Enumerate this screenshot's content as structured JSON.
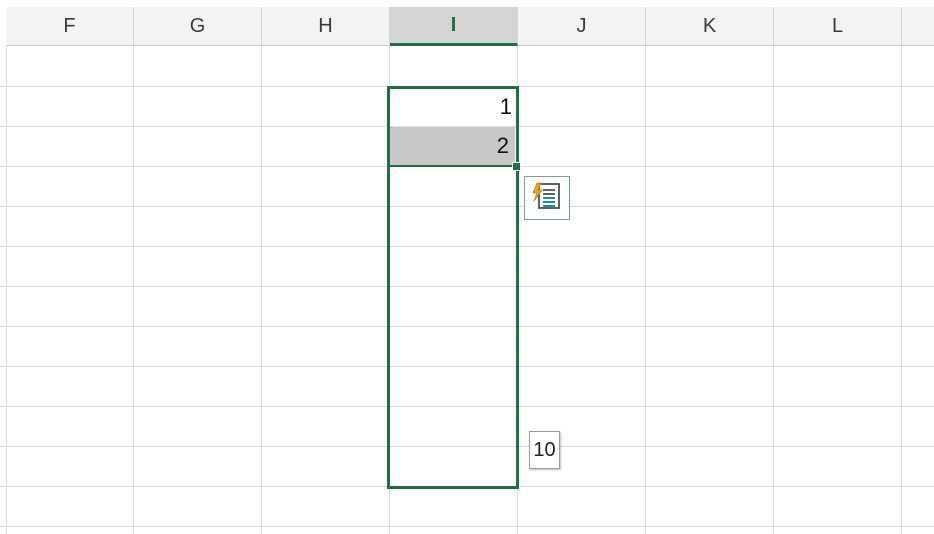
{
  "columns": [
    {
      "letter": "F",
      "selected": false
    },
    {
      "letter": "G",
      "selected": false
    },
    {
      "letter": "H",
      "selected": false
    },
    {
      "letter": "I",
      "selected": true
    },
    {
      "letter": "J",
      "selected": false
    },
    {
      "letter": "K",
      "selected": false
    },
    {
      "letter": "L",
      "selected": false
    }
  ],
  "cells": {
    "i_row1": "1",
    "i_row2": "2"
  },
  "fill_tooltip": "10",
  "autofill_icon": "flash-fill-options-icon",
  "colors": {
    "selection": "#1f6f43",
    "header_bg": "#f3f3f3",
    "header_selected_bg": "#d3d3d3",
    "active_cell_fill": "#c8c8c8",
    "gridline": "#dcdcdc"
  }
}
